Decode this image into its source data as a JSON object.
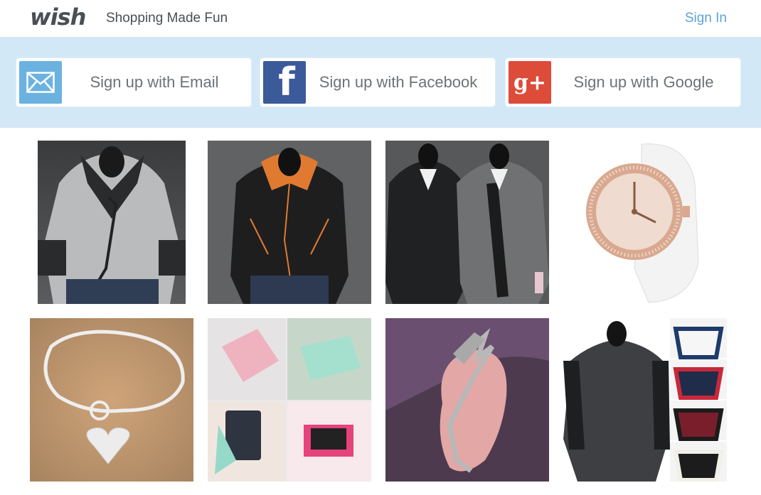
{
  "header": {
    "logo": "wish",
    "tagline": "Shopping Made Fun",
    "signin_label": "Sign In"
  },
  "signup": {
    "email_label": "Sign up with Email",
    "facebook_label": "Sign up with Facebook",
    "google_label": "Sign up with Google",
    "email_icon": "envelope-icon",
    "facebook_icon": "facebook-icon",
    "google_icon": "google-plus-icon"
  },
  "products": [
    {
      "name": "grey-zip-hoodie",
      "row": 1,
      "col": 1
    },
    {
      "name": "black-orange-hoodie",
      "row": 1,
      "col": 2
    },
    {
      "name": "two-blazers",
      "row": 1,
      "col": 3
    },
    {
      "name": "white-rose-gold-watch",
      "row": 1,
      "col": 4
    },
    {
      "name": "heart-lock-bracelet",
      "row": 2,
      "col": 1
    },
    {
      "name": "wallet-phone-case",
      "row": 2,
      "col": 2
    },
    {
      "name": "dragon-ear-cuff",
      "row": 2,
      "col": 3
    },
    {
      "name": "raglan-long-sleeve-shirt",
      "row": 2,
      "col": 4
    }
  ],
  "colors": {
    "band_bg": "#d3e8f7",
    "signin": "#5fa2d4",
    "email_icon_bg": "#6bb2e1",
    "facebook_icon_bg": "#3b5a99",
    "google_icon_bg": "#dd4b39"
  }
}
